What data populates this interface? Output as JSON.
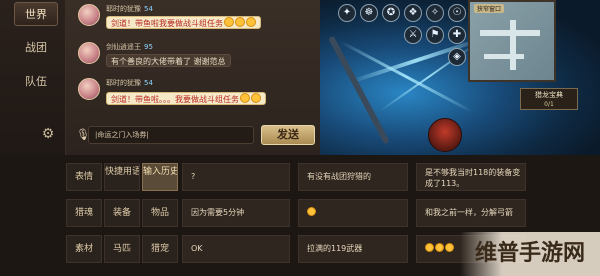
{
  "tabs": [
    {
      "label": "世界",
      "active": true
    },
    {
      "label": "战团",
      "active": false
    },
    {
      "label": "队伍",
      "active": false
    }
  ],
  "chat": {
    "messages": [
      {
        "name": "耶时的犹豫",
        "level": "54",
        "text": "剑道！带鱼啦我要做战斗组任务",
        "style": "gold",
        "emoji_count": 3
      },
      {
        "name": "剑仙逍遥王",
        "level": "95",
        "text": "有个善良的大佬带着了 谢谢范总",
        "style": "dark",
        "emoji_count": 0
      },
      {
        "name": "耶时的犹豫",
        "level": "54",
        "text": "剑道！带鱼啦。。。我要做战斗组任务",
        "style": "gold",
        "emoji_count": 2
      }
    ],
    "input_value": "|命运之门入场券|",
    "send_label": "发送"
  },
  "game": {
    "minimap_title": "狭窄窗口",
    "boss_name": "猎龙宝典",
    "boss_count": "0/1"
  },
  "quick": {
    "categories": [
      {
        "label": "表情",
        "active": false
      },
      {
        "label": "快捷用语",
        "active": false
      },
      {
        "label": "输入历史",
        "active": true
      },
      {
        "label": "猎魂",
        "active": false
      },
      {
        "label": "装备",
        "active": false
      },
      {
        "label": "物品",
        "active": false
      },
      {
        "label": "素材",
        "active": false
      },
      {
        "label": "马匹",
        "active": false
      },
      {
        "label": "猎宠",
        "active": false
      }
    ],
    "history": [
      "?",
      "有没有战团狩猎的",
      "是不够我当时118的装备变成了113。",
      "因为需要5分钟",
      "",
      "和我之前一样，分解弓箭",
      "OK",
      "拉满的119武器",
      ""
    ]
  },
  "watermark": "维普手游网"
}
